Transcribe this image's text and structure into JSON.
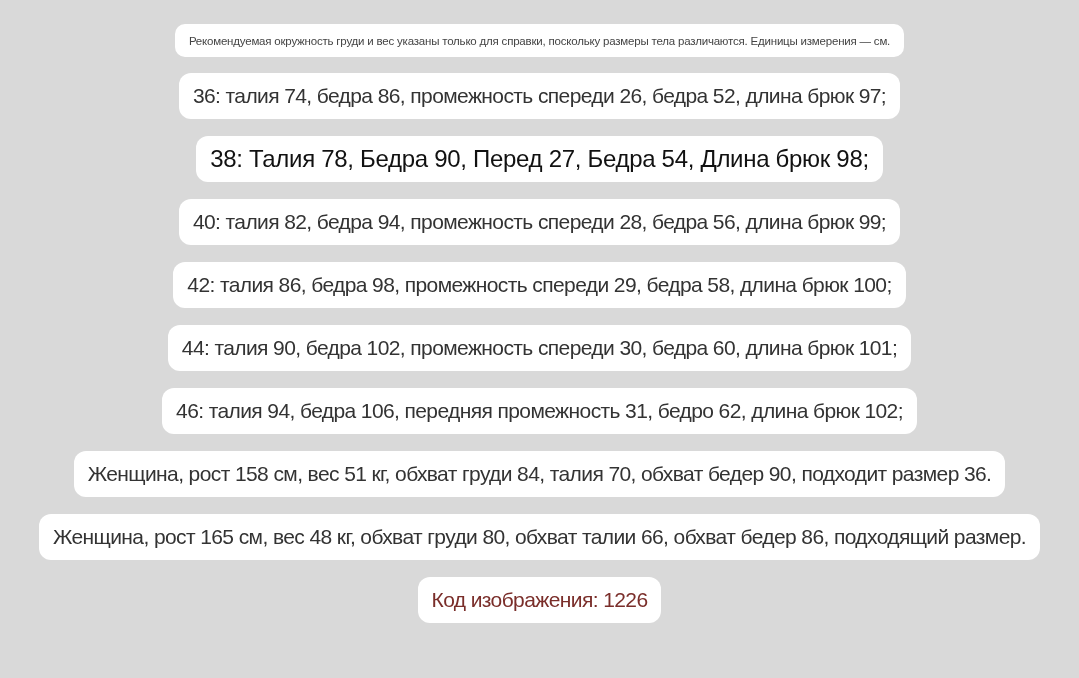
{
  "lines": [
    {
      "kind": "note",
      "text": "Рекомендуемая окружность груди и вес указаны только для справки, поскольку размеры тела различаются. Единицы измерения — см."
    },
    {
      "kind": "plain",
      "text": "36: талия 74, бедра 86, промежность спереди 26, бедра 52, длина брюк 97;"
    },
    {
      "kind": "strong",
      "text": "38: Талия 78, Бедра 90, Перед 27, Бедра 54, Длина брюк 98;"
    },
    {
      "kind": "plain",
      "text": "40: талия 82, бедра 94, промежность спереди 28, бедра 56, длина брюк 99;"
    },
    {
      "kind": "plain",
      "text": "42: талия 86, бедра 98, промежность спереди 29, бедра 58, длина брюк 100;"
    },
    {
      "kind": "plain",
      "text": "44: талия 90, бедра 102, промежность спереди 30, бедра 60, длина брюк 101;"
    },
    {
      "kind": "plain",
      "text": "46: талия 94, бедра 106, передняя промежность 31, бедро 62, длина брюк 102;"
    },
    {
      "kind": "plain",
      "text": "Женщина, рост 158 см, вес 51 кг, обхват груди 84, талия 70, обхват бедер 90, подходит размер 36."
    },
    {
      "kind": "plain",
      "text": "Женщина, рост 165 см, вес 48 кг, обхват груди 80, обхват талии 66, обхват бедер 86, подходящий размер."
    },
    {
      "kind": "code",
      "text": "Код изображения: 1226"
    }
  ]
}
